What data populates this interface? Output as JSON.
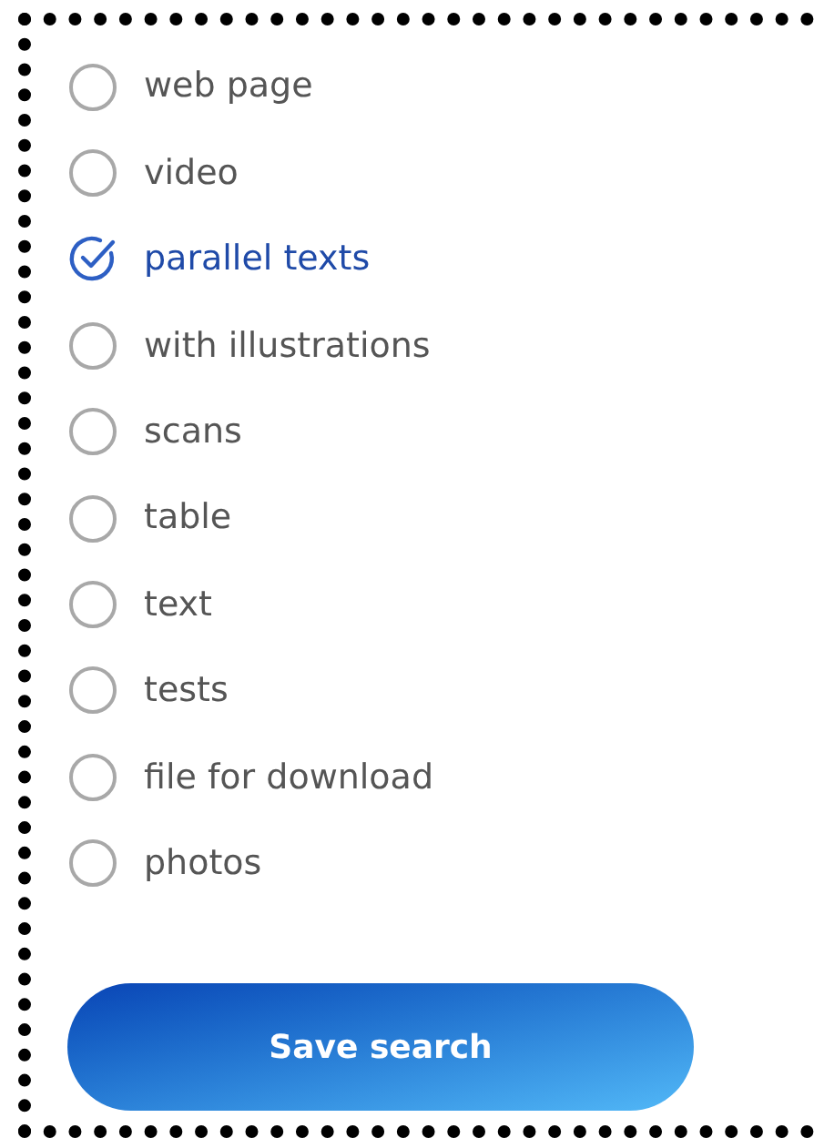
{
  "options": [
    {
      "label": "web page",
      "selected": false
    },
    {
      "label": "video",
      "selected": false
    },
    {
      "label": "parallel texts",
      "selected": true
    },
    {
      "label": "with illustrations",
      "selected": false
    },
    {
      "label": "scans",
      "selected": false
    },
    {
      "label": "table",
      "selected": false
    },
    {
      "label": "text",
      "selected": false
    },
    {
      "label": "tests",
      "selected": false
    },
    {
      "label": "file for download",
      "selected": false
    },
    {
      "label": "photos",
      "selected": false
    }
  ],
  "button": {
    "label": "Save search"
  }
}
